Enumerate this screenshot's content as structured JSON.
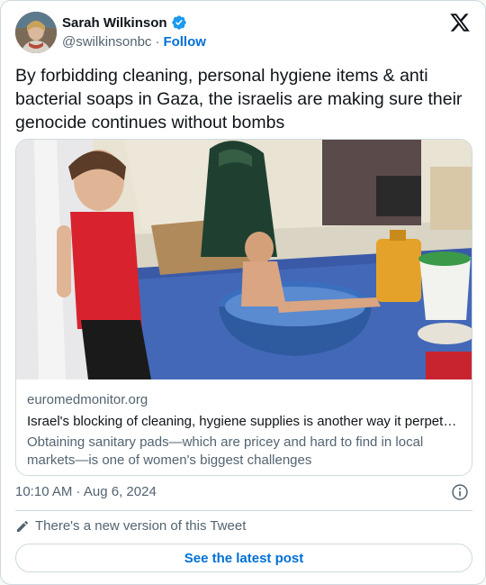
{
  "author": {
    "name": "Sarah Wilkinson",
    "handle": "@swilkinsonbc",
    "separator": "·",
    "follow_label": "Follow",
    "verified_color": "#1d9bf0"
  },
  "tweet": {
    "text": "By forbidding cleaning, personal hygiene items & anti bacterial soaps in Gaza, the israelis are making sure their genocide continues without bombs"
  },
  "link_card": {
    "domain": "euromedmonitor.org",
    "title": "Israel's blocking of cleaning, hygiene supplies is another way it perpetu…",
    "description": "Obtaining sanitary pads—which are pricey and hard to find in local markets—is one of women's biggest challenges"
  },
  "meta": {
    "timestamp": "10:10 AM · Aug 6, 2024"
  },
  "notice": {
    "text": "There's a new version of this Tweet",
    "button_label": "See the latest post"
  },
  "colors": {
    "accent": "#006fd6",
    "secondary_text": "#536471",
    "border": "#cfd9de"
  },
  "icons": [
    "verified-badge-icon",
    "x-logo-icon",
    "info-icon",
    "pencil-icon"
  ]
}
